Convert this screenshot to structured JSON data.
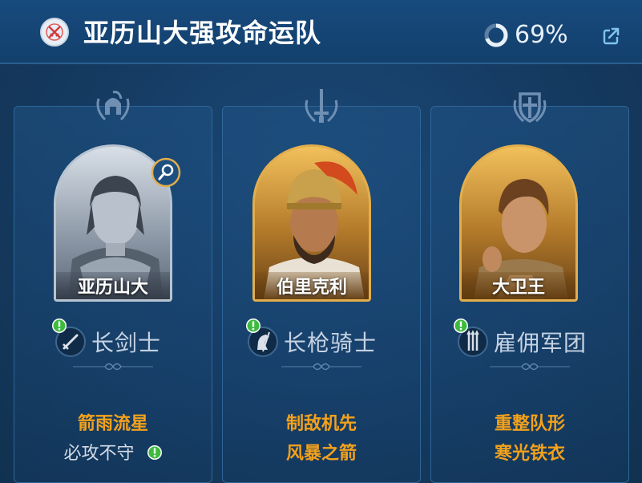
{
  "header": {
    "team_name": "亚历山大强攻命运队",
    "progress_percent": 69,
    "progress_label": "69%",
    "team_icon": "crossed-swords-icon",
    "share_icon": "share-export-icon"
  },
  "cards": [
    {
      "role_emblem": "helmet-laurel-icon",
      "commander_name": "亚历山大",
      "portrait_style": "silver",
      "has_magnify_badge": true,
      "troop_type": "长剑士",
      "troop_icon": "sword-icon",
      "troop_alert": true,
      "skills": [
        {
          "name": "箭雨流星",
          "style": "orange",
          "alert": false
        },
        {
          "name": "必攻不守",
          "style": "grey",
          "alert": true
        }
      ]
    },
    {
      "role_emblem": "sword-laurel-icon",
      "commander_name": "伯里克利",
      "portrait_style": "gold",
      "has_magnify_badge": false,
      "troop_type": "长枪骑士",
      "troop_icon": "horse-icon",
      "troop_alert": true,
      "skills": [
        {
          "name": "制敌机先",
          "style": "orange",
          "alert": false
        },
        {
          "name": "风暴之箭",
          "style": "orange",
          "alert": false
        }
      ]
    },
    {
      "role_emblem": "shield-laurel-icon",
      "commander_name": "大卫王",
      "portrait_style": "gold",
      "has_magnify_badge": false,
      "troop_type": "雇佣军团",
      "troop_icon": "spears-icon",
      "troop_alert": true,
      "skills": [
        {
          "name": "重整队形",
          "style": "orange",
          "alert": false
        },
        {
          "name": "寒光铁衣",
          "style": "orange",
          "alert": false
        }
      ]
    }
  ],
  "colors": {
    "background": "#163d66",
    "header": "#174a7e",
    "skill_orange": "#f3a11b",
    "alert_green": "#3dbb3d",
    "gold_frame": "#e2ae4d",
    "silver_frame": "#b7c4d2"
  }
}
